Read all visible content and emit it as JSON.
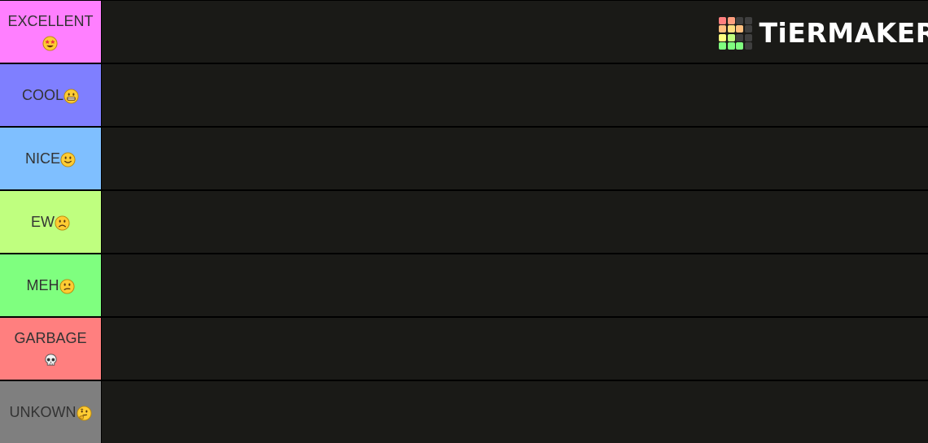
{
  "brand": {
    "name": "TiERMAKER",
    "logo_colors": [
      [
        "#ff7f7f",
        "#ff9f7f",
        "#3f3f3f",
        "#3f3f3f"
      ],
      [
        "#ffbf7f",
        "#ffdf7f",
        "#ffbf7f",
        "#3f3f3f"
      ],
      [
        "#ffff7f",
        "#bfff7f",
        "#3f3f3f",
        "#3f3f3f"
      ],
      [
        "#7fff7f",
        "#7fff7f",
        "#7fff7f",
        "#3f3f3f"
      ]
    ]
  },
  "tiers": [
    {
      "label": "EXCELLENT",
      "emoji": "star-struck",
      "color": "#ff7fff",
      "stacked": true
    },
    {
      "label": "COOL",
      "emoji": "grinning",
      "color": "#7f7fff",
      "stacked": false
    },
    {
      "label": "NICE",
      "emoji": "slightly-smiling",
      "color": "#7fbfff",
      "stacked": false
    },
    {
      "label": "EW",
      "emoji": "frowning",
      "color": "#bfff7f",
      "stacked": false
    },
    {
      "label": "MEH",
      "emoji": "confused",
      "color": "#7fff7f",
      "stacked": false
    },
    {
      "label": "GARBAGE",
      "emoji": "skull",
      "color": "#ff7f7f",
      "stacked": true
    },
    {
      "label": "UNKOWN",
      "emoji": "thinking",
      "color": "#7f7f7f",
      "stacked": false
    }
  ]
}
